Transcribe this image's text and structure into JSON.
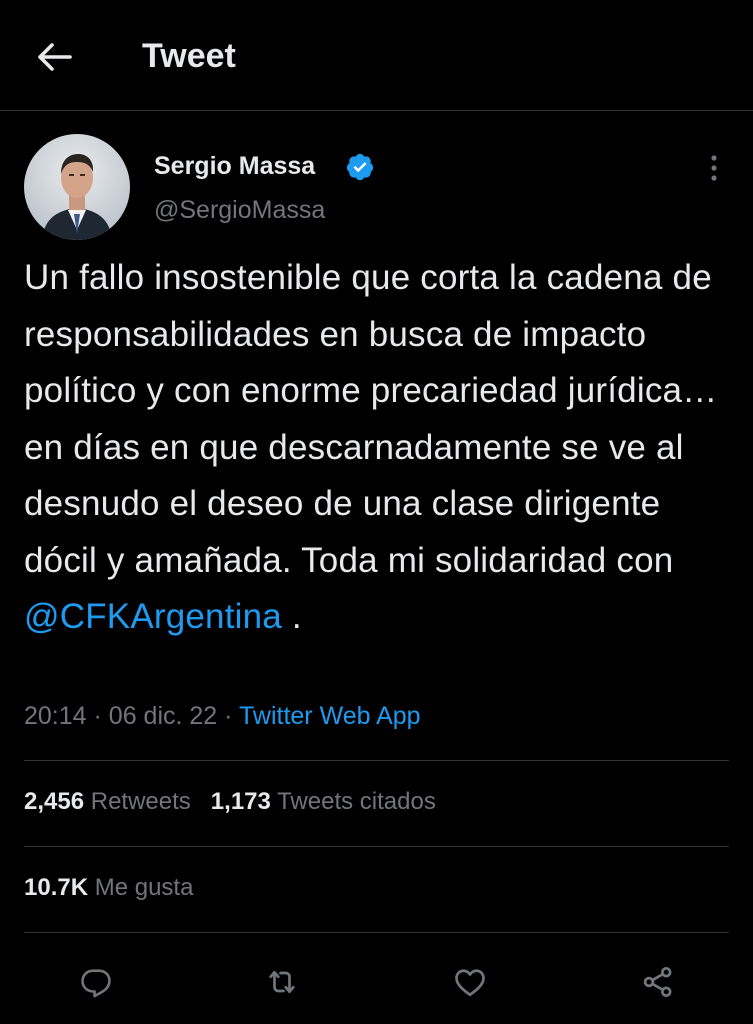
{
  "header": {
    "back_icon": "arrow-left-icon",
    "title": "Tweet"
  },
  "author": {
    "name": "Sergio Massa",
    "handle": "@SergioMassa",
    "verified": true,
    "verified_color": "#1d9bf0"
  },
  "tweet": {
    "text_before": "Un fallo insostenible que corta la cadena de responsabilidades en busca de impacto político y con enorme precariedad jurídica… en días en que descarnadamente se ve al desnudo el deseo de una clase dirigente dócil y amañada. Toda mi solidaridad con",
    "mention": "@CFKArgentina",
    "text_after": " .",
    "time": "20:14",
    "separator": "·",
    "date": "06 dic. 22",
    "source": "Twitter Web App"
  },
  "stats": {
    "retweets_count": "2,456",
    "retweets_label": "Retweets",
    "quotes_count": "1,173",
    "quotes_label": "Tweets citados",
    "likes_count": "10.7K",
    "likes_label": "Me gusta"
  },
  "actions": [
    {
      "icon": "reply-icon"
    },
    {
      "icon": "retweet-icon"
    },
    {
      "icon": "like-icon"
    },
    {
      "icon": "share-icon"
    }
  ],
  "colors": {
    "background": "#000000",
    "text_primary": "#e7e9ea",
    "text_secondary": "#71767b",
    "accent": "#1d9bf0",
    "divider": "#2f3336"
  }
}
